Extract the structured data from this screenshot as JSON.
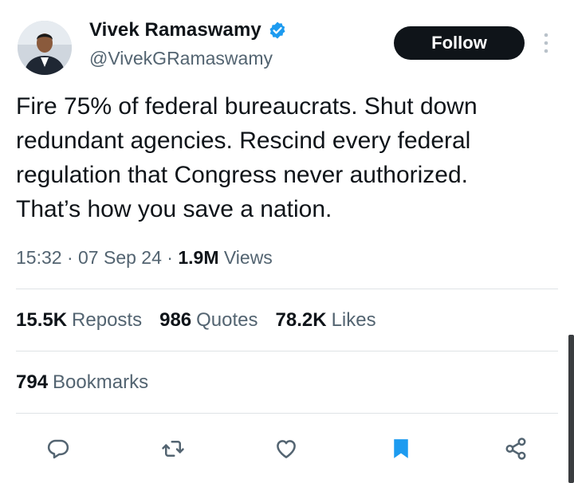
{
  "author": {
    "display_name": "Vivek Ramaswamy",
    "handle": "@VivekGRamaswamy",
    "verified": true
  },
  "follow_label": "Follow",
  "tweet": {
    "text": "Fire 75% of federal bureaucrats. Shut down\nredundant agencies. Rescind every federal\nregulation that Congress never authorized.\nThat’s how you save a nation."
  },
  "meta": {
    "time": "15:32",
    "date": "07 Sep 24",
    "separator": "·",
    "views_count": "1.9M",
    "views_label": "Views"
  },
  "stats": {
    "reposts_count": "15.5K",
    "reposts_label": "Reposts",
    "quotes_count": "986",
    "quotes_label": "Quotes",
    "likes_count": "78.2K",
    "likes_label": "Likes",
    "bookmarks_count": "794",
    "bookmarks_label": "Bookmarks"
  },
  "actions": [
    "reply-icon",
    "repost-icon",
    "like-icon",
    "bookmark-icon",
    "share-icon"
  ],
  "colors": {
    "text": "#0f1419",
    "secondary": "#536471",
    "accent": "#1d9bf0",
    "follow_bg": "#0f1419"
  }
}
